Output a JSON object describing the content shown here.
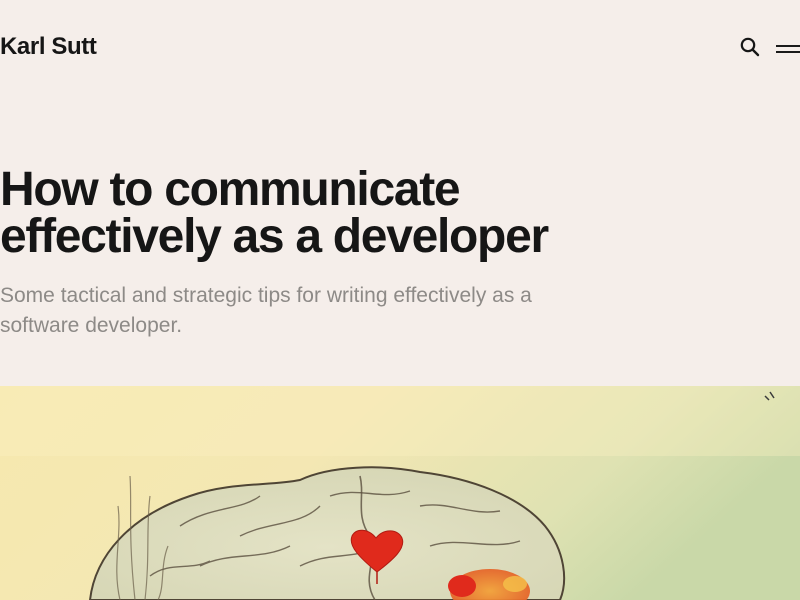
{
  "header": {
    "brand": "Karl Sutt",
    "icons": {
      "search": "search-icon",
      "menu": "hamburger-menu-icon"
    }
  },
  "article": {
    "title": "How to communicate effectively as a developer",
    "subtitle": "Some tactical and strategic tips for writing effectively as a software developer."
  },
  "cover_image": {
    "subject": "painted brain with red hearts illustration",
    "colors": {
      "background_light": "#f6eab2",
      "background_green": "#cfdcab",
      "brain_outline": "#5a4f3e",
      "heart": "#e02a1c",
      "flower": "#f08a2e"
    }
  },
  "colors": {
    "page_background": "#f5eeea",
    "text_primary": "#161616",
    "text_muted": "#8d8a87"
  }
}
